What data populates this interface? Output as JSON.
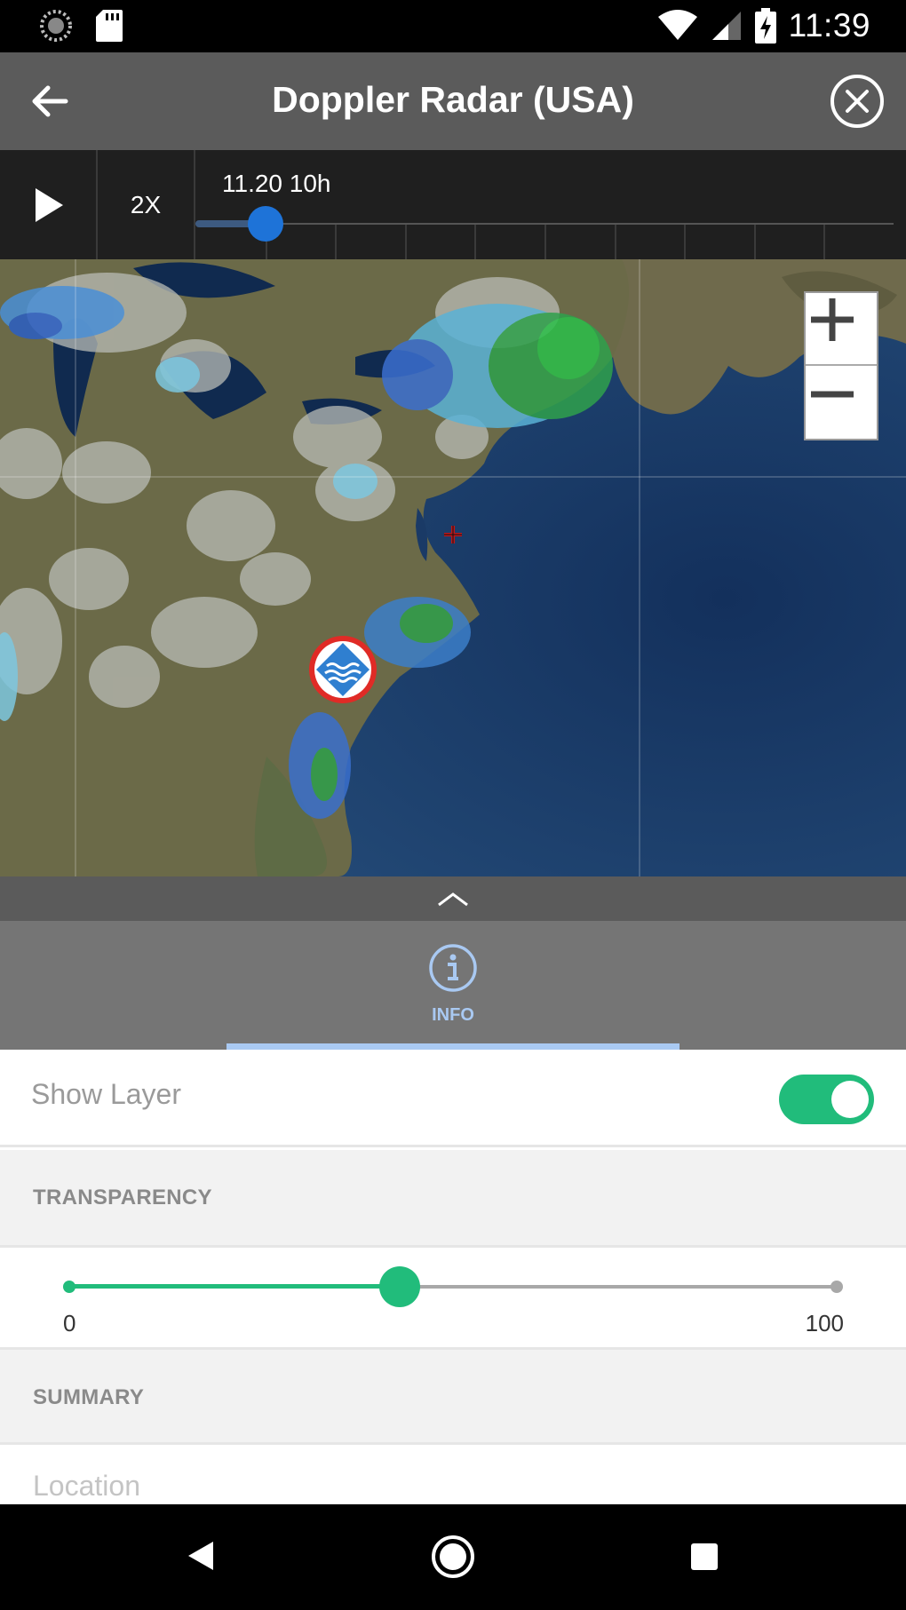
{
  "status_bar": {
    "time": "11:39",
    "icons": [
      "sync-icon",
      "sd-card-icon",
      "wifi-icon",
      "signal-icon",
      "battery-charging-icon"
    ]
  },
  "app_bar": {
    "title": "Doppler Radar (USA)",
    "back_icon": "arrow-back-icon",
    "close_icon": "close-circle-icon"
  },
  "timeline": {
    "play_icon": "play-icon",
    "speed_label": "2X",
    "time_label": "11.20 10h",
    "position_fraction": 0.1,
    "tick_count": 9
  },
  "map": {
    "zoom_in_icon": "plus-icon",
    "zoom_out_icon": "minus-icon",
    "marker_icon": "water-waves-marker-icon",
    "crosshair_icon": "crosshair-icon",
    "ocean_color": "#1c3f6e",
    "land_color": "#6b6a48"
  },
  "panel_handle": {
    "icon": "chevron-up-icon"
  },
  "tabs": [
    {
      "label": "INFO",
      "icon": "info-icon",
      "active": true,
      "color": "#a9c9f2"
    }
  ],
  "layer": {
    "show_layer_label": "Show Layer",
    "show_layer_on": true,
    "accent_color": "#21bc7b"
  },
  "transparency": {
    "header": "TRANSPARENCY",
    "min_label": "0",
    "max_label": "100",
    "value_fraction": 0.43
  },
  "summary": {
    "header": "SUMMARY",
    "location_label": "Location"
  },
  "nav_bar": {
    "icons": [
      "nav-back-icon",
      "nav-home-icon",
      "nav-recents-icon"
    ]
  }
}
